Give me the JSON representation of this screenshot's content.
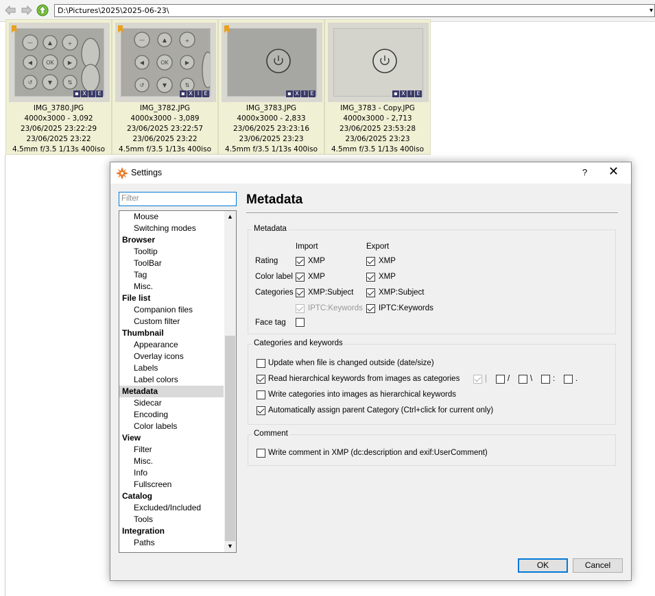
{
  "address": {
    "path": "D:\\Pictures\\2025\\2025-06-23\\"
  },
  "thumbnails": [
    {
      "name": "IMG_3780.JPG",
      "size": "4000x3000 - 3,092",
      "modified": "23/06/2025 23:22:29",
      "taken": "23/06/2025 23:22",
      "exif": "4.5mm f/3.5 1/13s 400iso"
    },
    {
      "name": "IMG_3782.JPG",
      "size": "4000x3000 - 3,089",
      "modified": "23/06/2025 23:22:57",
      "taken": "23/06/2025 23:22",
      "exif": "4.5mm f/3.5 1/13s 400iso"
    },
    {
      "name": "IMG_3783.JPG",
      "size": "4000x3000 - 2,833",
      "modified": "23/06/2025 23:23:16",
      "taken": "23/06/2025 23:23",
      "exif": "4.5mm f/3.5 1/13s 400iso"
    },
    {
      "name": "IMG_3783 - Copy.JPG",
      "size": "4000x3000 - 2,713",
      "modified": "23/06/2025 23:53:28",
      "taken": "23/06/2025 23:23",
      "exif": "4.5mm f/3.5 1/13s 400iso"
    }
  ],
  "overlay_icons": [
    "X",
    "I",
    "E"
  ],
  "dialog": {
    "title": "Settings",
    "help": "?",
    "close": "✕",
    "filter_placeholder": "Filter",
    "tree": [
      {
        "label": "Mouse",
        "level": 1
      },
      {
        "label": "Switching modes",
        "level": 1
      },
      {
        "label": "Browser",
        "level": 0
      },
      {
        "label": "Tooltip",
        "level": 1
      },
      {
        "label": "ToolBar",
        "level": 1
      },
      {
        "label": "Tag",
        "level": 1
      },
      {
        "label": "Misc.",
        "level": 1
      },
      {
        "label": "File list",
        "level": 0
      },
      {
        "label": "Companion files",
        "level": 1
      },
      {
        "label": "Custom filter",
        "level": 1
      },
      {
        "label": "Thumbnail",
        "level": 0
      },
      {
        "label": "Appearance",
        "level": 1
      },
      {
        "label": "Overlay icons",
        "level": 1
      },
      {
        "label": "Labels",
        "level": 1
      },
      {
        "label": "Label colors",
        "level": 1
      },
      {
        "label": "Metadata",
        "level": 0,
        "selected": true
      },
      {
        "label": "Sidecar",
        "level": 1
      },
      {
        "label": "Encoding",
        "level": 1
      },
      {
        "label": "Color labels",
        "level": 1
      },
      {
        "label": "View",
        "level": 0
      },
      {
        "label": "Filter",
        "level": 1
      },
      {
        "label": "Misc.",
        "level": 1
      },
      {
        "label": "Info",
        "level": 1
      },
      {
        "label": "Fullscreen",
        "level": 1
      },
      {
        "label": "Catalog",
        "level": 0
      },
      {
        "label": "Excluded/Included",
        "level": 1
      },
      {
        "label": "Tools",
        "level": 1
      },
      {
        "label": "Integration",
        "level": 0
      },
      {
        "label": "Paths",
        "level": 1
      }
    ],
    "page_title": "Metadata",
    "metadata_group": {
      "title": "Metadata",
      "import_header": "Import",
      "export_header": "Export",
      "row_rating": "Rating",
      "row_color_label": "Color label",
      "row_categories": "Categories",
      "row_face_tag": "Face tag",
      "xmp": "XMP",
      "xmp_subject": "XMP:Subject",
      "iptc_keywords": "IPTC:Keywords"
    },
    "categories_group": {
      "title": "Categories and keywords",
      "update_outside": "Update when file is changed outside (date/size)",
      "read_hierarchical": "Read hierarchical keywords from images as categories",
      "write_hierarchical": "Write categories into images as hierarchical keywords",
      "auto_parent": "Automatically assign parent Category (Ctrl+click for current only)",
      "separators": [
        "|",
        "/",
        "\\",
        ":",
        "."
      ]
    },
    "comment_group": {
      "title": "Comment",
      "write_comment": "Write comment in XMP (dc:description and exif:UserComment)"
    },
    "ok": "OK",
    "cancel": "Cancel"
  }
}
